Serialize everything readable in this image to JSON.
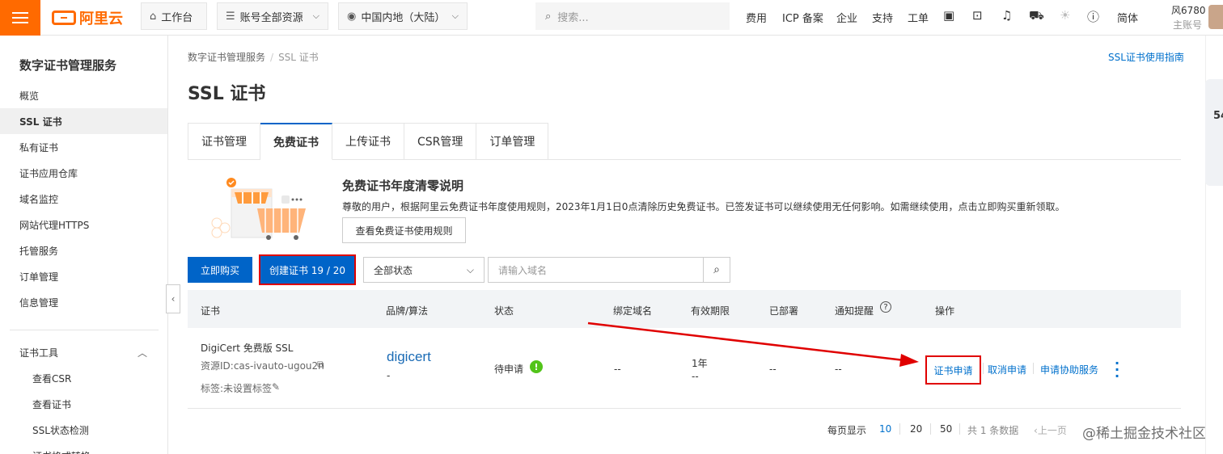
{
  "topbar": {
    "logo_text": "阿里云",
    "workbench": "工作台",
    "account_resources": "账号全部资源",
    "region": "中国内地（大陆）",
    "search_placeholder": "搜索...",
    "links": [
      "费用",
      "ICP 备案",
      "企业",
      "支持",
      "工单"
    ],
    "language": "简体",
    "user_name": "风6780",
    "user_role": "主账号"
  },
  "sidebar": {
    "title": "数字证书管理服务",
    "items": [
      "概览",
      "SSL 证书",
      "私有证书",
      "证书应用仓库",
      "域名监控",
      "网站代理HTTPS",
      "托管服务",
      "订单管理",
      "信息管理"
    ],
    "active": "SSL 证书",
    "tools_group": "证书工具",
    "tools": [
      "查看CSR",
      "查看证书",
      "SSL状态检测",
      "证书格式转换"
    ]
  },
  "breadcrumb": [
    "数字证书管理服务",
    "SSL 证书"
  ],
  "guide_link": "SSL证书使用指南",
  "page_title": "SSL 证书",
  "tabs": [
    "证书管理",
    "免费证书",
    "上传证书",
    "CSR管理",
    "订单管理"
  ],
  "active_tab": "免费证书",
  "notice": {
    "title": "免费证书年度清零说明",
    "text": "尊敬的用户，根据阿里云免费证书年度使用规则，2023年1月1日0点清除历史免费证书。已签发证书可以继续使用无任何影响。如需继续使用，点击立即购买重新领取。",
    "button": "查看免费证书使用规则"
  },
  "toolbar": {
    "buy": "立即购买",
    "create": "创建证书 19 / 20",
    "status": "全部状态",
    "domain_placeholder": "请输入域名"
  },
  "table": {
    "headers": [
      "证书",
      "品牌/算法",
      "状态",
      "绑定域名",
      "有效期限",
      "已部署",
      "通知提醒",
      "操作"
    ],
    "row": {
      "name": "DigiCert 免费版 SSL",
      "resource_id": "资源ID:cas-ivauto-ugou2n",
      "tag": "标签:未设置标签",
      "brand": "digicert",
      "brand_sub": "-",
      "status": "待申请",
      "domain": "--",
      "validity": "1年",
      "validity_sub": "--",
      "deployed": "--",
      "notify": "--",
      "ops": [
        "证书申请",
        "取消申请",
        "申请协助服务"
      ]
    }
  },
  "pagination": {
    "per_page_label": "每页显示",
    "sizes": [
      "10",
      "20",
      "50"
    ],
    "total": "共 1 条数据",
    "prev": "上一页"
  },
  "watermark": "@稀土掘金技术社区",
  "rail_number": "54",
  "colors": {
    "brand": "#ff6a00",
    "primary": "#0064c8",
    "link": "#0070cc",
    "highlight": "#e00000",
    "success": "#52c41a"
  }
}
